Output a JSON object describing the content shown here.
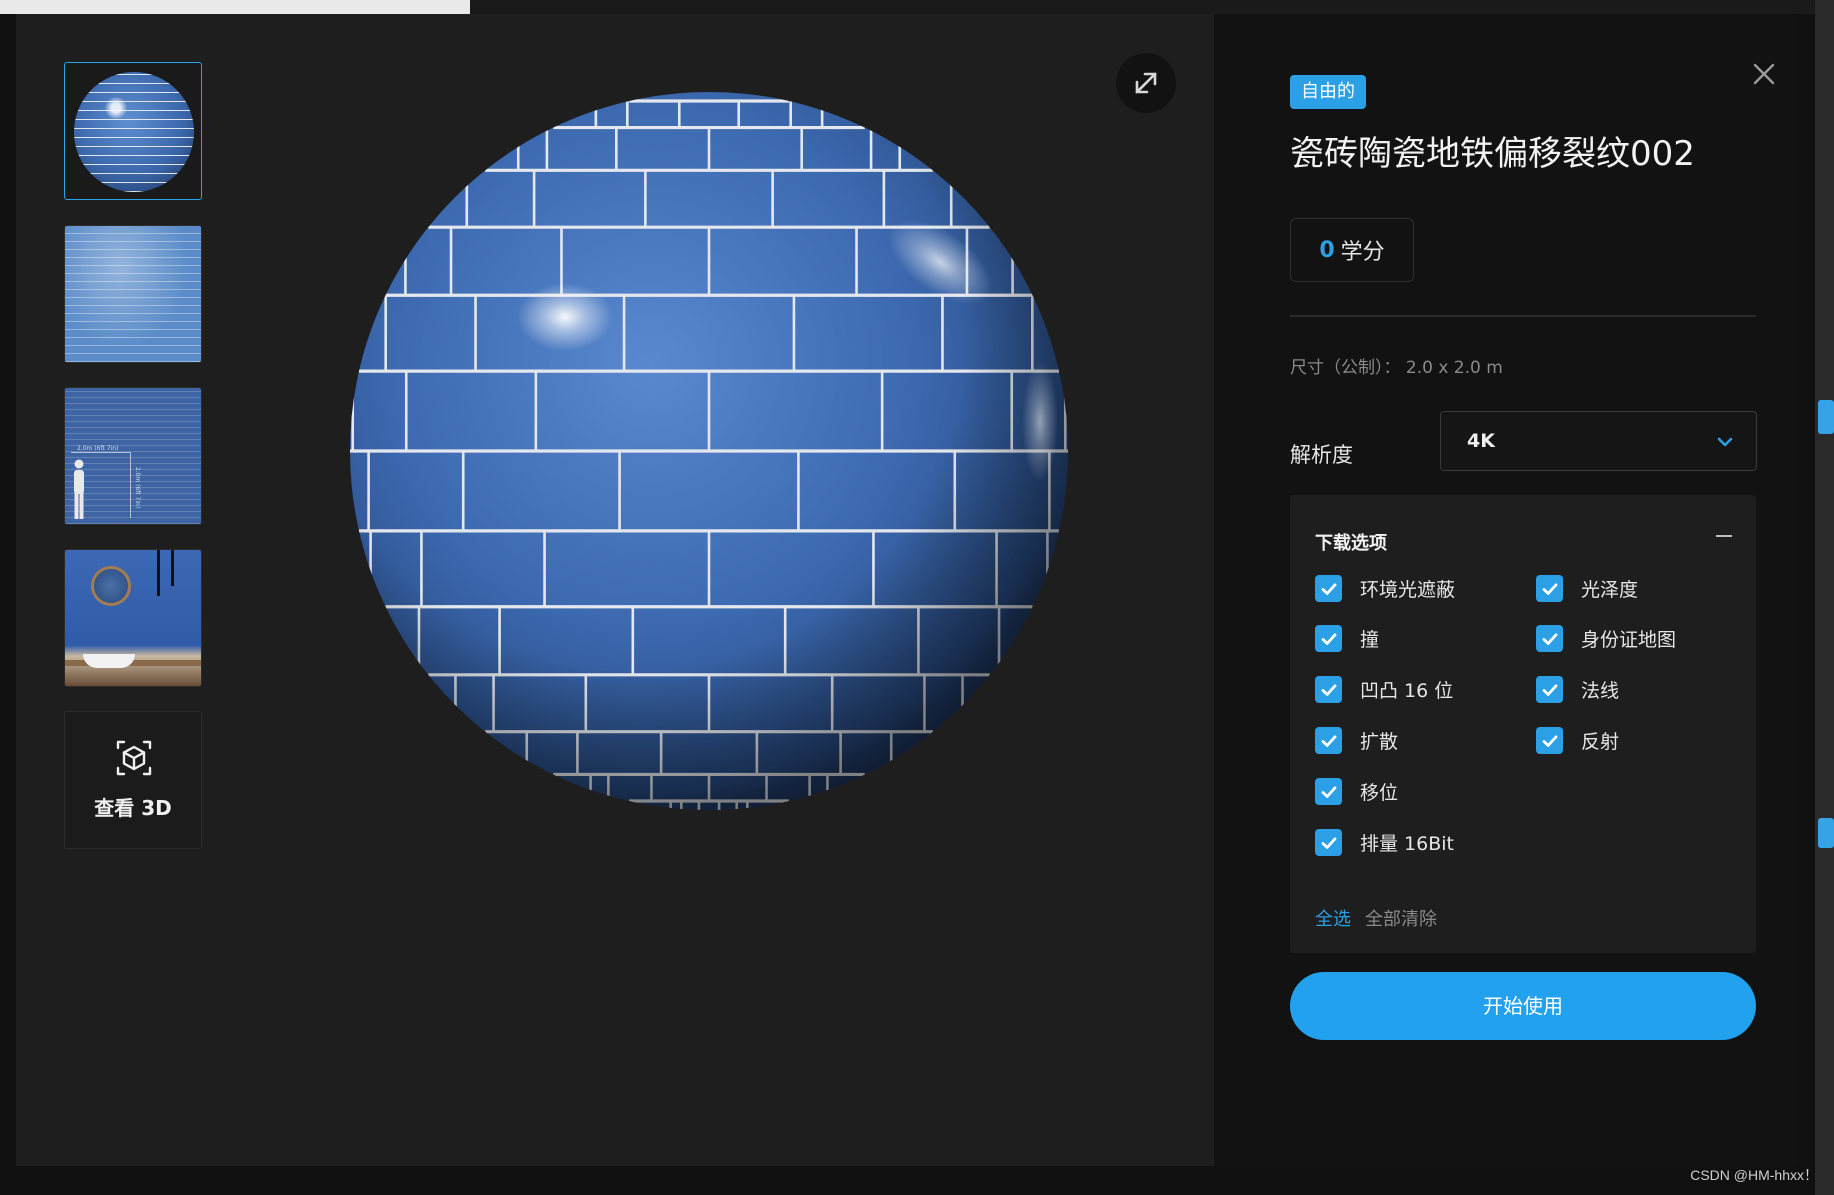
{
  "asset": {
    "badge": "自由的",
    "title": "瓷砖陶瓷地铁偏移裂纹002",
    "credits_value": "0",
    "credits_unit": "学分",
    "dimensions": "尺寸（公制）： 2.0 x 2.0 m"
  },
  "resolution": {
    "label": "解析度",
    "selected": "4K"
  },
  "download_options": {
    "title": "下载选项",
    "left": [
      {
        "label": "环境光遮蔽",
        "checked": true
      },
      {
        "label": "撞",
        "checked": true
      },
      {
        "label": "凹凸 16 位",
        "checked": true
      },
      {
        "label": "扩散",
        "checked": true
      },
      {
        "label": "移位",
        "checked": true
      },
      {
        "label": "排量 16Bit",
        "checked": true
      }
    ],
    "right": [
      {
        "label": "光泽度",
        "checked": true
      },
      {
        "label": "身份证地图",
        "checked": true
      },
      {
        "label": "法线",
        "checked": true
      },
      {
        "label": "反射",
        "checked": true
      }
    ],
    "select_all": "全选",
    "clear_all": "全部清除"
  },
  "primary_action": "开始使用",
  "viewer": {
    "view_3d_label": "查看 3D",
    "scale_label_h": "2.0m (6ft 7in)",
    "scale_label_v": "2.0m (6ft 7in)"
  },
  "watermark": "CSDN @HM-hhxx！",
  "colors": {
    "accent": "#2ba0e6",
    "tile_blue": "#3f6fb7",
    "panel_bg": "#121212",
    "viewer_bg": "#1e1e1e"
  }
}
